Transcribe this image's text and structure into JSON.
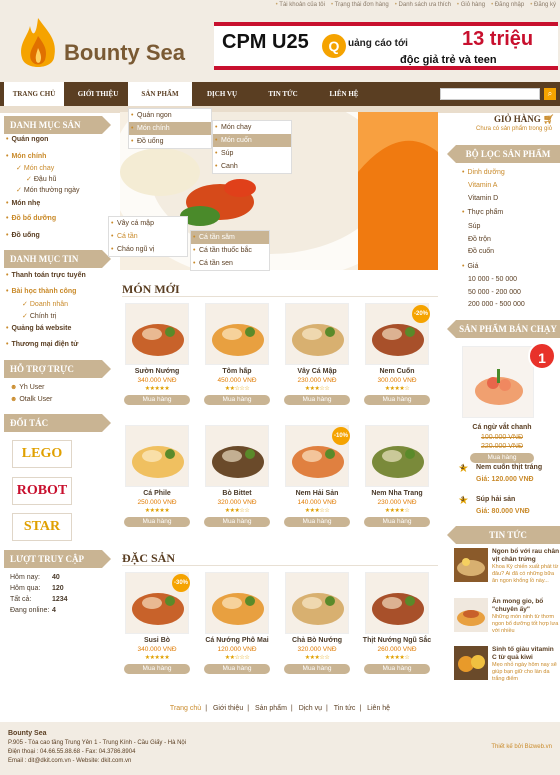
{
  "top_links": [
    "Tài khoản của tôi",
    "Trạng thái đơn hàng",
    "Danh sách ưa thích",
    "Giỏ hàng",
    "Đăng nhập",
    "Đăng ký"
  ],
  "brand": "Bounty Sea",
  "banner": {
    "line1": "CPM U25",
    "q": "Q",
    "line2": "uảng cáo tới",
    "big": "13 triệu",
    "line3": "độc giả trẻ và teen"
  },
  "nav": [
    "TRANG CHỦ",
    "GIỚI THIỆU",
    "SẢN PHẨM",
    "DỊCH VỤ",
    "TIN TỨC",
    "LIÊN HỆ"
  ],
  "left": {
    "cat_title": "DANH MỤC SẢN PHẨM",
    "cat": {
      "quan_ngon": "Quán ngon",
      "mon_chinh": "Món chính",
      "mon_chay": "Món chay",
      "dau_hu": "Đậu hũ",
      "mon_thuong": "Món thường ngày",
      "mon_nhe": "Món nhẹ",
      "do_bo": "Đồ bổ dưỡng",
      "do_uong": "Đồ uống"
    },
    "news_title": "DANH MỤC TIN",
    "news": {
      "a": "Thanh toán trực tuyến",
      "b": "Bài học thành công",
      "c": "Doanh nhân",
      "d": "Chính trị",
      "e": "Quảng bá website",
      "f": "Thương mại điện tử"
    },
    "support_title": "HỖ TRỢ TRỰC TUYẾN",
    "support": [
      "Yh User",
      "Otalk User"
    ],
    "partners_title": "ĐỐI TÁC",
    "partners": [
      "LEGO",
      "ROBOT",
      "STAR"
    ],
    "stats_title": "LƯỢT TRUY CẬP",
    "stats": [
      {
        "k": "Hôm nay:",
        "v": "40"
      },
      {
        "k": "Hôm qua:",
        "v": "120"
      },
      {
        "k": "Tất cả:",
        "v": "1234"
      },
      {
        "k": "Đang online:",
        "v": "4"
      }
    ]
  },
  "menus": {
    "sanpham": [
      "Quán ngon",
      "Món chính",
      "Đồ uống"
    ],
    "monchinh": [
      "Món chay",
      "Món cuốn",
      "Súp",
      "Canh"
    ],
    "ca": [
      "Vây cá mập",
      "Cá tần",
      "Cháo ngũ vị"
    ],
    "catan": [
      "Cá tần sâm",
      "Cá tần thuốc bắc",
      "Cá tần sen"
    ]
  },
  "section1": "MÓN MỚI",
  "section2": "ĐẶC SẢN",
  "buy": "Mua hàng",
  "products": [
    {
      "name": "Sườn Nướng",
      "price": "340.000 VNĐ",
      "stars": "★★★★★"
    },
    {
      "name": "Tôm hấp",
      "price": "450.000 VNĐ",
      "stars": "★★☆☆☆"
    },
    {
      "name": "Vây Cá Mập",
      "price": "230.000 VNĐ",
      "stars": "★★★☆☆"
    },
    {
      "name": "Nem Cuốn",
      "price": "300.000 VNĐ",
      "stars": "★★★★☆",
      "badge": "-20%"
    },
    {
      "name": "Cá Phile",
      "price": "250.000 VNĐ",
      "stars": "★★★★★"
    },
    {
      "name": "Bò Bittet",
      "price": "320.000 VNĐ",
      "stars": "★★★☆☆"
    },
    {
      "name": "Nem Hải Sản",
      "price": "140.000 VNĐ",
      "stars": "★★★☆☆",
      "badge": "-10%"
    },
    {
      "name": "Nem Nha Trang",
      "price": "230.000 VNĐ",
      "stars": "★★★★☆"
    }
  ],
  "specials": [
    {
      "name": "Susi Bò",
      "price": "340.000 VNĐ",
      "stars": "★★★★★",
      "badge": "-30%"
    },
    {
      "name": "Cá Nướng Phô Mai",
      "price": "120.000 VNĐ",
      "stars": "★★☆☆☆"
    },
    {
      "name": "Chả Bò Nướng",
      "price": "320.000 VNĐ",
      "stars": "★★★☆☆"
    },
    {
      "name": "Thịt Nướng Ngũ Sắc",
      "price": "260.000 VNĐ",
      "stars": "★★★★☆"
    }
  ],
  "right": {
    "cart_title": "GIỎ HÀNG",
    "cart_empty": "Chưa có sản phẩm trong giỏ",
    "filter_title": "BỘ LỌC SẢN PHẨM",
    "filter": {
      "dinh_duong": "Dinh dưỡng",
      "vitamin_a": "Vitamin A",
      "vitamin_d": "Vitamin D",
      "thuc_pham": "Thực phẩm",
      "sup": "Súp",
      "do_tron": "Đồ trộn",
      "do_cuon": "Đồ cuốn",
      "gia": "Giá",
      "p1": "10 000 - 50 000",
      "p2": "50 000 - 200 000",
      "p3": "200 000 - 500 000"
    },
    "best_title": "SẢN PHẨM BÁN CHẠY",
    "best_main": {
      "rank": "1",
      "name": "Cá ngừ vắt chanh",
      "old": "100.000 VNĐ",
      "old2": "220.000 VNĐ",
      "buy": "Mua hàng"
    },
    "best_2": {
      "rank": "2",
      "name": "Nem cuốn thịt tráng",
      "price": "Giá: 120.000 VNĐ"
    },
    "best_3": {
      "rank": "3",
      "name": "Súp hải sản",
      "price": "Giá: 80.000 VNĐ"
    },
    "news_title": "TIN TỨC",
    "news": [
      {
        "title": "Ngon bổ với rau chân vịt chân trứng",
        "desc": "Khoa Kỳ chiến xuất phát từ đâu? Ai đã có những bữa ăn ngon khổng lồ này..."
      },
      {
        "title": "Ăn mong gio, bổ \"chuyên ấy\"",
        "desc": "Những món ninh từ thơm ngon bổ dưỡng tốt hợp lưa với nhiều"
      },
      {
        "title": "Sinh tố giàu vitamin C từ quả kiwi",
        "desc": "Mẹo nhỏ ngày hôm nay sẽ giúp bạn giữ cho làn da trắng điểm"
      }
    ]
  },
  "footer_nav": [
    "Trang chủ",
    "Giới thiệu",
    "Sản phẩm",
    "Dịch vụ",
    "Tin tức",
    "Liên hệ"
  ],
  "footer": {
    "name": "Bounty Sea",
    "addr": "P.905 - Tòa cao tầng Trung Yên 1 - Trung Kính - Cầu Giấy - Hà Nội",
    "phone": "Điện thoại : 04.66.55.88.68 - Fax: 04.3786.8904",
    "email": "Email : dit@dkit.com.vn - Website: dkit.com.vn",
    "design": "Thiết kế bởi Bizweb.vn"
  }
}
